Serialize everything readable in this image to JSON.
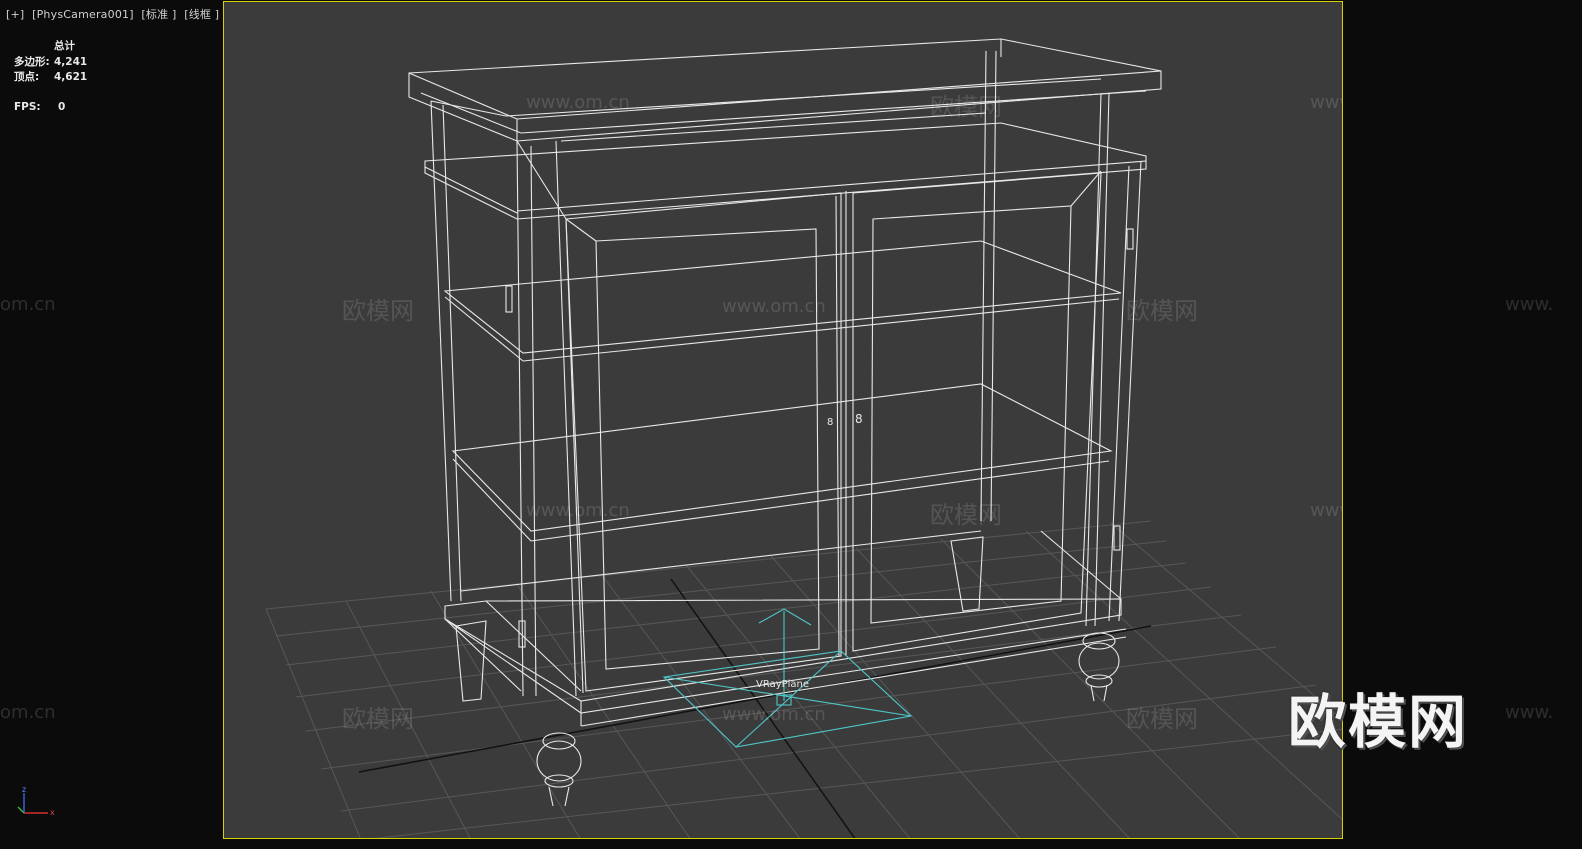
{
  "viewport": {
    "menu_plus": "[+]",
    "camera": "[PhysCamera001]",
    "shading_mode": "[标准 ]",
    "display_mode": "[线框 ]",
    "border_color": "#d8d000",
    "background_color": "#3b3b3b"
  },
  "stats": {
    "header": "总计",
    "polys_label": "多边形:",
    "polys_value": "4,241",
    "verts_label": "顶点:",
    "verts_value": "4,621",
    "fps_label": "FPS:",
    "fps_value": "0"
  },
  "scene": {
    "helper_label": "VRayPlane",
    "handle_labels": [
      "8",
      "8"
    ]
  },
  "watermarks": {
    "brand": "欧模网",
    "url": "www.om.cn",
    "url_partial": "om.cn",
    "url_prefix": "www.",
    "brand_large": "欧模网"
  },
  "axis_gizmo": {
    "z": "z",
    "x": "x",
    "colors": {
      "x": "#d03030",
      "y": "#40b040",
      "z": "#4060d0"
    }
  },
  "colors": {
    "wire": "#eeeeee",
    "grid": "#555555",
    "helper": "#4fc6c8"
  }
}
